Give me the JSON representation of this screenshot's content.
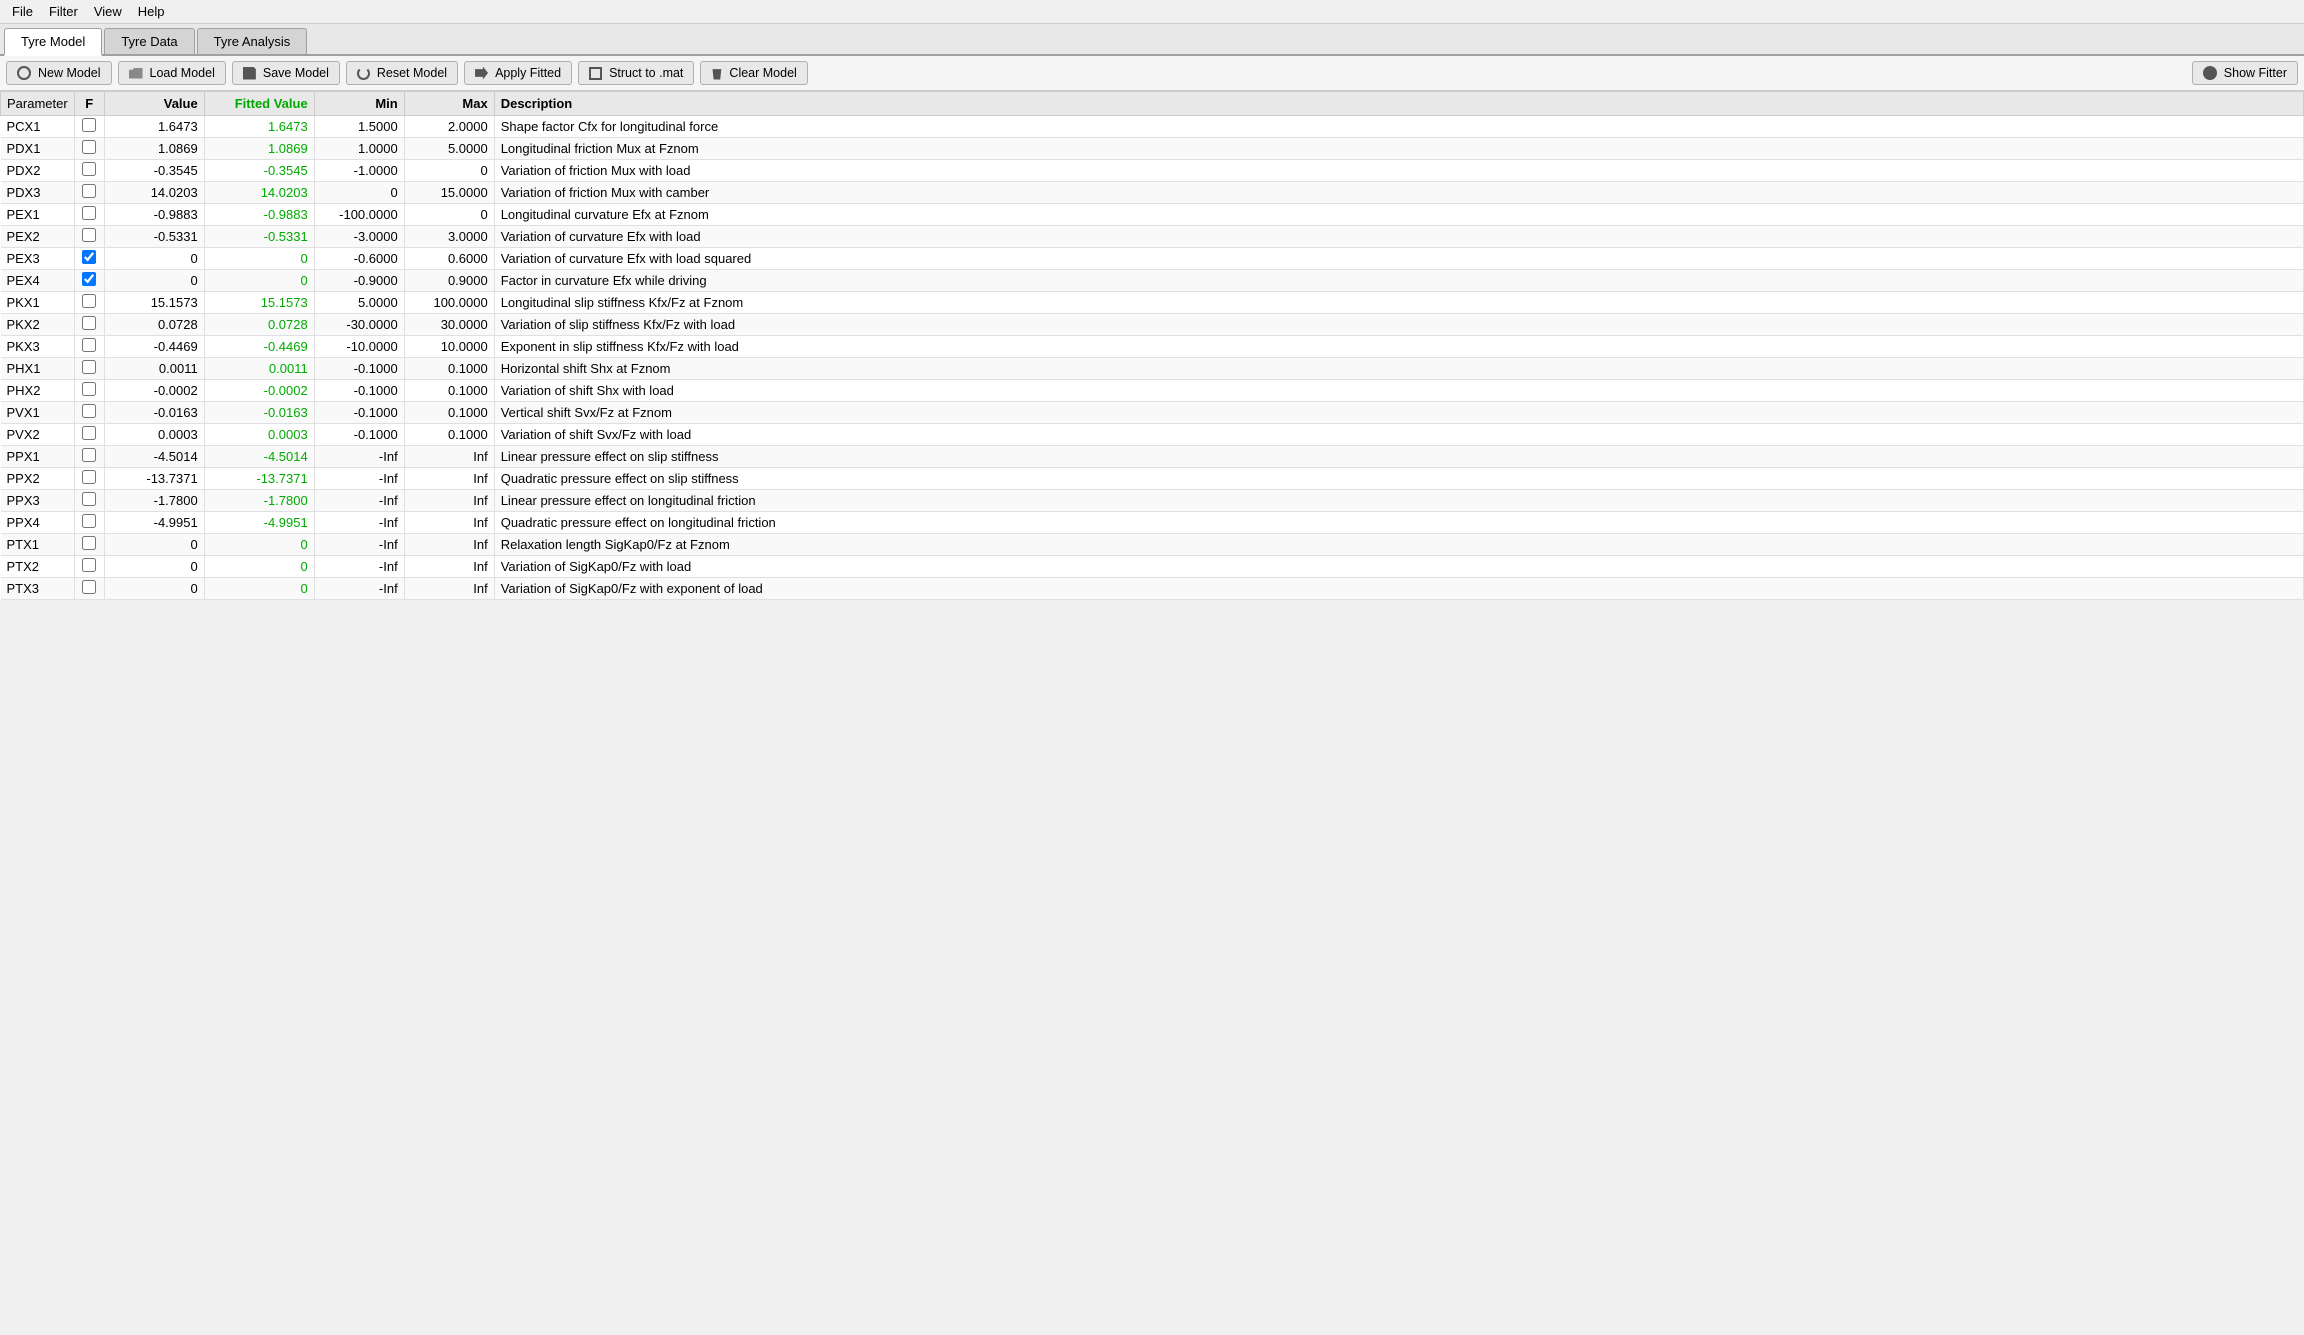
{
  "menu": {
    "items": [
      "File",
      "Filter",
      "View",
      "Help"
    ]
  },
  "tabs": [
    {
      "label": "Tyre Model",
      "active": true
    },
    {
      "label": "Tyre Data",
      "active": false
    },
    {
      "label": "Tyre Analysis",
      "active": false
    }
  ],
  "toolbar": {
    "buttons": [
      {
        "id": "new-model",
        "label": "New Model",
        "icon": "new-icon"
      },
      {
        "id": "load-model",
        "label": "Load Model",
        "icon": "folder-icon"
      },
      {
        "id": "save-model",
        "label": "Save Model",
        "icon": "save-icon"
      },
      {
        "id": "reset-model",
        "label": "Reset Model",
        "icon": "reset-icon"
      },
      {
        "id": "apply-fitted",
        "label": "Apply Fitted",
        "icon": "apply-icon"
      },
      {
        "id": "struct-to-mat",
        "label": "Struct to .mat",
        "icon": "struct-icon"
      },
      {
        "id": "clear-model",
        "label": "Clear Model",
        "icon": "trash-icon"
      }
    ],
    "right_button": {
      "id": "show-fitter",
      "label": "Show Fitter",
      "icon": "gear-icon"
    }
  },
  "table": {
    "headers": [
      "Parameter",
      "F",
      "Value",
      "Fitted Value",
      "Min",
      "Max",
      "Description"
    ],
    "rows": [
      {
        "param": "PCX1",
        "f": false,
        "value": "1.6473",
        "fitted": "1.6473",
        "fitted_color": "green",
        "min": "1.5000",
        "max": "2.0000",
        "desc": "Shape factor Cfx for longitudinal force"
      },
      {
        "param": "PDX1",
        "f": false,
        "value": "1.0869",
        "fitted": "1.0869",
        "fitted_color": "green",
        "min": "1.0000",
        "max": "5.0000",
        "desc": "Longitudinal friction Mux at Fznom"
      },
      {
        "param": "PDX2",
        "f": false,
        "value": "-0.3545",
        "fitted": "-0.3545",
        "fitted_color": "green",
        "min": "-1.0000",
        "max": "0",
        "desc": "Variation of friction Mux with load"
      },
      {
        "param": "PDX3",
        "f": false,
        "value": "14.0203",
        "fitted": "14.0203",
        "fitted_color": "green",
        "min": "0",
        "max": "15.0000",
        "desc": "Variation of friction Mux with camber"
      },
      {
        "param": "PEX1",
        "f": false,
        "value": "-0.9883",
        "fitted": "-0.9883",
        "fitted_color": "green",
        "min": "-100.0000",
        "max": "0",
        "desc": "Longitudinal curvature Efx at Fznom"
      },
      {
        "param": "PEX2",
        "f": false,
        "value": "-0.5331",
        "fitted": "-0.5331",
        "fitted_color": "green",
        "min": "-3.0000",
        "max": "3.0000",
        "desc": "Variation of curvature Efx with load"
      },
      {
        "param": "PEX3",
        "f": true,
        "value": "0",
        "fitted": "0",
        "fitted_color": "green",
        "min": "-0.6000",
        "max": "0.6000",
        "desc": "Variation of curvature Efx with load squared"
      },
      {
        "param": "PEX4",
        "f": true,
        "value": "0",
        "fitted": "0",
        "fitted_color": "green",
        "min": "-0.9000",
        "max": "0.9000",
        "desc": "Factor in curvature Efx while driving"
      },
      {
        "param": "PKX1",
        "f": false,
        "value": "15.1573",
        "fitted": "15.1573",
        "fitted_color": "green",
        "min": "5.0000",
        "max": "100.0000",
        "desc": "Longitudinal slip stiffness Kfx/Fz at Fznom"
      },
      {
        "param": "PKX2",
        "f": false,
        "value": "0.0728",
        "fitted": "0.0728",
        "fitted_color": "green",
        "min": "-30.0000",
        "max": "30.0000",
        "desc": "Variation of slip stiffness Kfx/Fz with load"
      },
      {
        "param": "PKX3",
        "f": false,
        "value": "-0.4469",
        "fitted": "-0.4469",
        "fitted_color": "green",
        "min": "-10.0000",
        "max": "10.0000",
        "desc": "Exponent in slip stiffness Kfx/Fz with load"
      },
      {
        "param": "PHX1",
        "f": false,
        "value": "0.0011",
        "fitted": "0.0011",
        "fitted_color": "green",
        "min": "-0.1000",
        "max": "0.1000",
        "desc": "Horizontal shift Shx at Fznom"
      },
      {
        "param": "PHX2",
        "f": false,
        "value": "-0.0002",
        "fitted": "-0.0002",
        "fitted_color": "green",
        "min": "-0.1000",
        "max": "0.1000",
        "desc": "Variation of shift Shx with load"
      },
      {
        "param": "PVX1",
        "f": false,
        "value": "-0.0163",
        "fitted": "-0.0163",
        "fitted_color": "green",
        "min": "-0.1000",
        "max": "0.1000",
        "desc": "Vertical shift Svx/Fz at Fznom"
      },
      {
        "param": "PVX2",
        "f": false,
        "value": "0.0003",
        "fitted": "0.0003",
        "fitted_color": "green",
        "min": "-0.1000",
        "max": "0.1000",
        "desc": "Variation of shift Svx/Fz with load"
      },
      {
        "param": "PPX1",
        "f": false,
        "value": "-4.5014",
        "fitted": "-4.5014",
        "fitted_color": "green",
        "min": "-Inf",
        "max": "Inf",
        "desc": "Linear pressure effect on slip stiffness"
      },
      {
        "param": "PPX2",
        "f": false,
        "value": "-13.7371",
        "fitted": "-13.7371",
        "fitted_color": "green",
        "min": "-Inf",
        "max": "Inf",
        "desc": "Quadratic pressure effect on slip stiffness"
      },
      {
        "param": "PPX3",
        "f": false,
        "value": "-1.7800",
        "fitted": "-1.7800",
        "fitted_color": "green",
        "min": "-Inf",
        "max": "Inf",
        "desc": "Linear pressure effect on longitudinal friction"
      },
      {
        "param": "PPX4",
        "f": false,
        "value": "-4.9951",
        "fitted": "-4.9951",
        "fitted_color": "green",
        "min": "-Inf",
        "max": "Inf",
        "desc": "Quadratic pressure effect on longitudinal friction"
      },
      {
        "param": "PTX1",
        "f": false,
        "value": "0",
        "fitted": "0",
        "fitted_color": "green",
        "min": "-Inf",
        "max": "Inf",
        "desc": "Relaxation length SigKap0/Fz at Fznom"
      },
      {
        "param": "PTX2",
        "f": false,
        "value": "0",
        "fitted": "0",
        "fitted_color": "green",
        "min": "-Inf",
        "max": "Inf",
        "desc": "Variation of SigKap0/Fz with load"
      },
      {
        "param": "PTX3",
        "f": false,
        "value": "0",
        "fitted": "0",
        "fitted_color": "green",
        "min": "-Inf",
        "max": "Inf",
        "desc": "Variation of SigKap0/Fz with exponent of load"
      }
    ]
  }
}
